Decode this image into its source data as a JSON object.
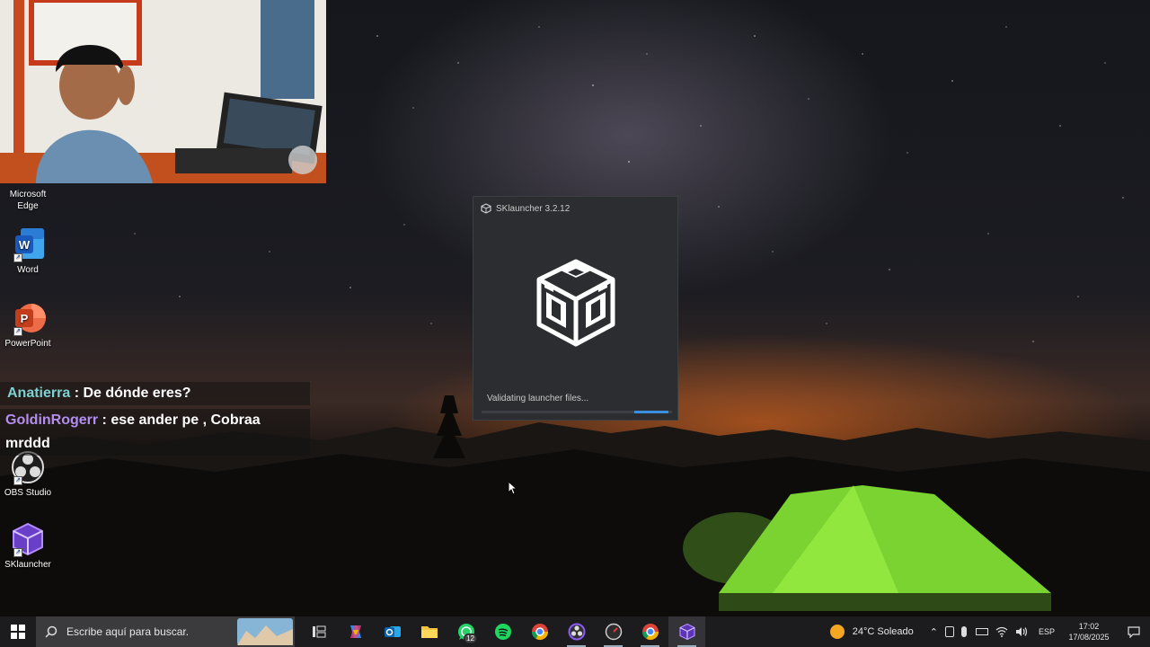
{
  "desktop": {
    "icons": [
      {
        "label_line1": "Microsoft",
        "label_line2": "Edge",
        "icon": "edge-icon"
      },
      {
        "label_line1": "Word",
        "label_line2": "",
        "icon": "word-icon"
      },
      {
        "label_line1": "PowerPoint",
        "label_line2": "",
        "icon": "powerpoint-icon"
      },
      {
        "label_line1": "OBS Studio",
        "label_line2": "",
        "icon": "obs-icon"
      },
      {
        "label_line1": "SKlauncher",
        "label_line2": "",
        "icon": "sklauncher-icon"
      }
    ],
    "shortcut_arrow": "↗"
  },
  "chat": {
    "messages": [
      {
        "user": "Anatierra",
        "text": " : De dónde eres?"
      },
      {
        "user": "GoldinRogerr",
        "text": " : ese ander pe , Cobraa mrddd"
      }
    ]
  },
  "launcher": {
    "title": "SKlauncher 3.2.12",
    "status": "Validating launcher files...",
    "progress": 0.18
  },
  "taskbar": {
    "search_placeholder": "Escribe aquí para buscar.",
    "apps": [
      {
        "name": "task-view",
        "icon": "task-view-icon"
      },
      {
        "name": "copilot",
        "icon": "copilot-icon"
      },
      {
        "name": "outlook",
        "icon": "outlook-icon"
      },
      {
        "name": "file-explorer",
        "icon": "folder-icon"
      },
      {
        "name": "whatsapp",
        "icon": "whatsapp-icon",
        "badge": "12"
      },
      {
        "name": "spotify",
        "icon": "spotify-icon"
      },
      {
        "name": "chrome",
        "icon": "chrome-icon"
      },
      {
        "name": "obs",
        "icon": "obs-icon"
      },
      {
        "name": "clock-app",
        "icon": "speed-icon"
      },
      {
        "name": "chrome-2",
        "icon": "chrome-icon"
      },
      {
        "name": "sklauncher",
        "icon": "sklauncher-icon"
      }
    ],
    "weather": "24°C  Soleado",
    "language": "ESP",
    "time": "17:02",
    "date": "17/08/2025"
  }
}
